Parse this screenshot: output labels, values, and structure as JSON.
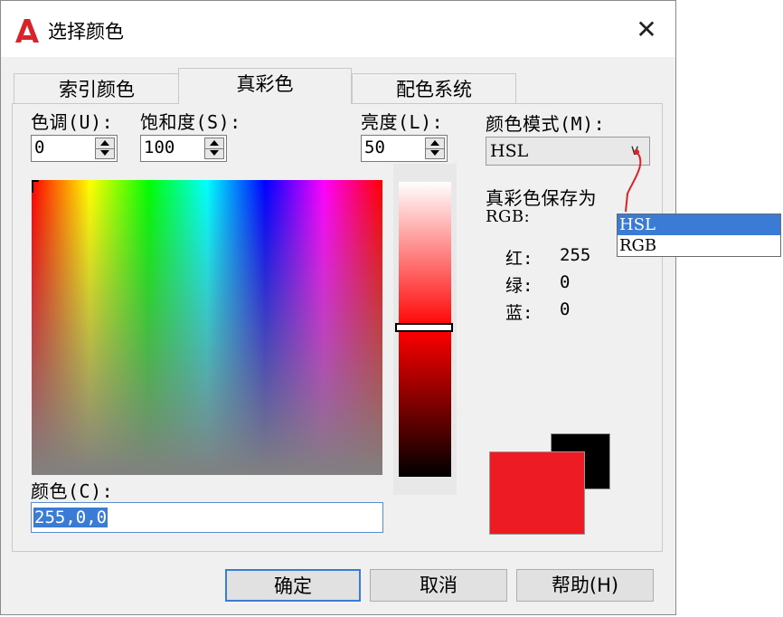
{
  "window": {
    "title": "选择颜色",
    "close_glyph": "✕"
  },
  "tabs": [
    {
      "label": "索引颜色",
      "active": false
    },
    {
      "label": "真彩色",
      "active": true
    },
    {
      "label": "配色系统",
      "active": false
    }
  ],
  "hue": {
    "label": "色调(U):",
    "value": "0"
  },
  "saturation": {
    "label": "饱和度(S):",
    "value": "100"
  },
  "luminance": {
    "label": "亮度(L):",
    "value": "50"
  },
  "color_model": {
    "label": "颜色模式(M):",
    "selected": "HSL",
    "options": [
      "HSL",
      "RGB"
    ]
  },
  "save_as": {
    "line1": "真彩色保存为",
    "line2": "RGB:"
  },
  "rgb": {
    "red_label": "红:",
    "red": "255",
    "green_label": "绿:",
    "green": "0",
    "blue_label": "蓝:",
    "blue": "0"
  },
  "color": {
    "label": "颜色(C):",
    "value": "255,0,0"
  },
  "swatches": {
    "new_color": "#ed1c24",
    "old_color": "#000000"
  },
  "buttons": {
    "ok": "确定",
    "cancel": "取消",
    "help": "帮助(H)"
  },
  "colors": {
    "accent": "#3a7bd5",
    "annotation": "#d9232a"
  }
}
